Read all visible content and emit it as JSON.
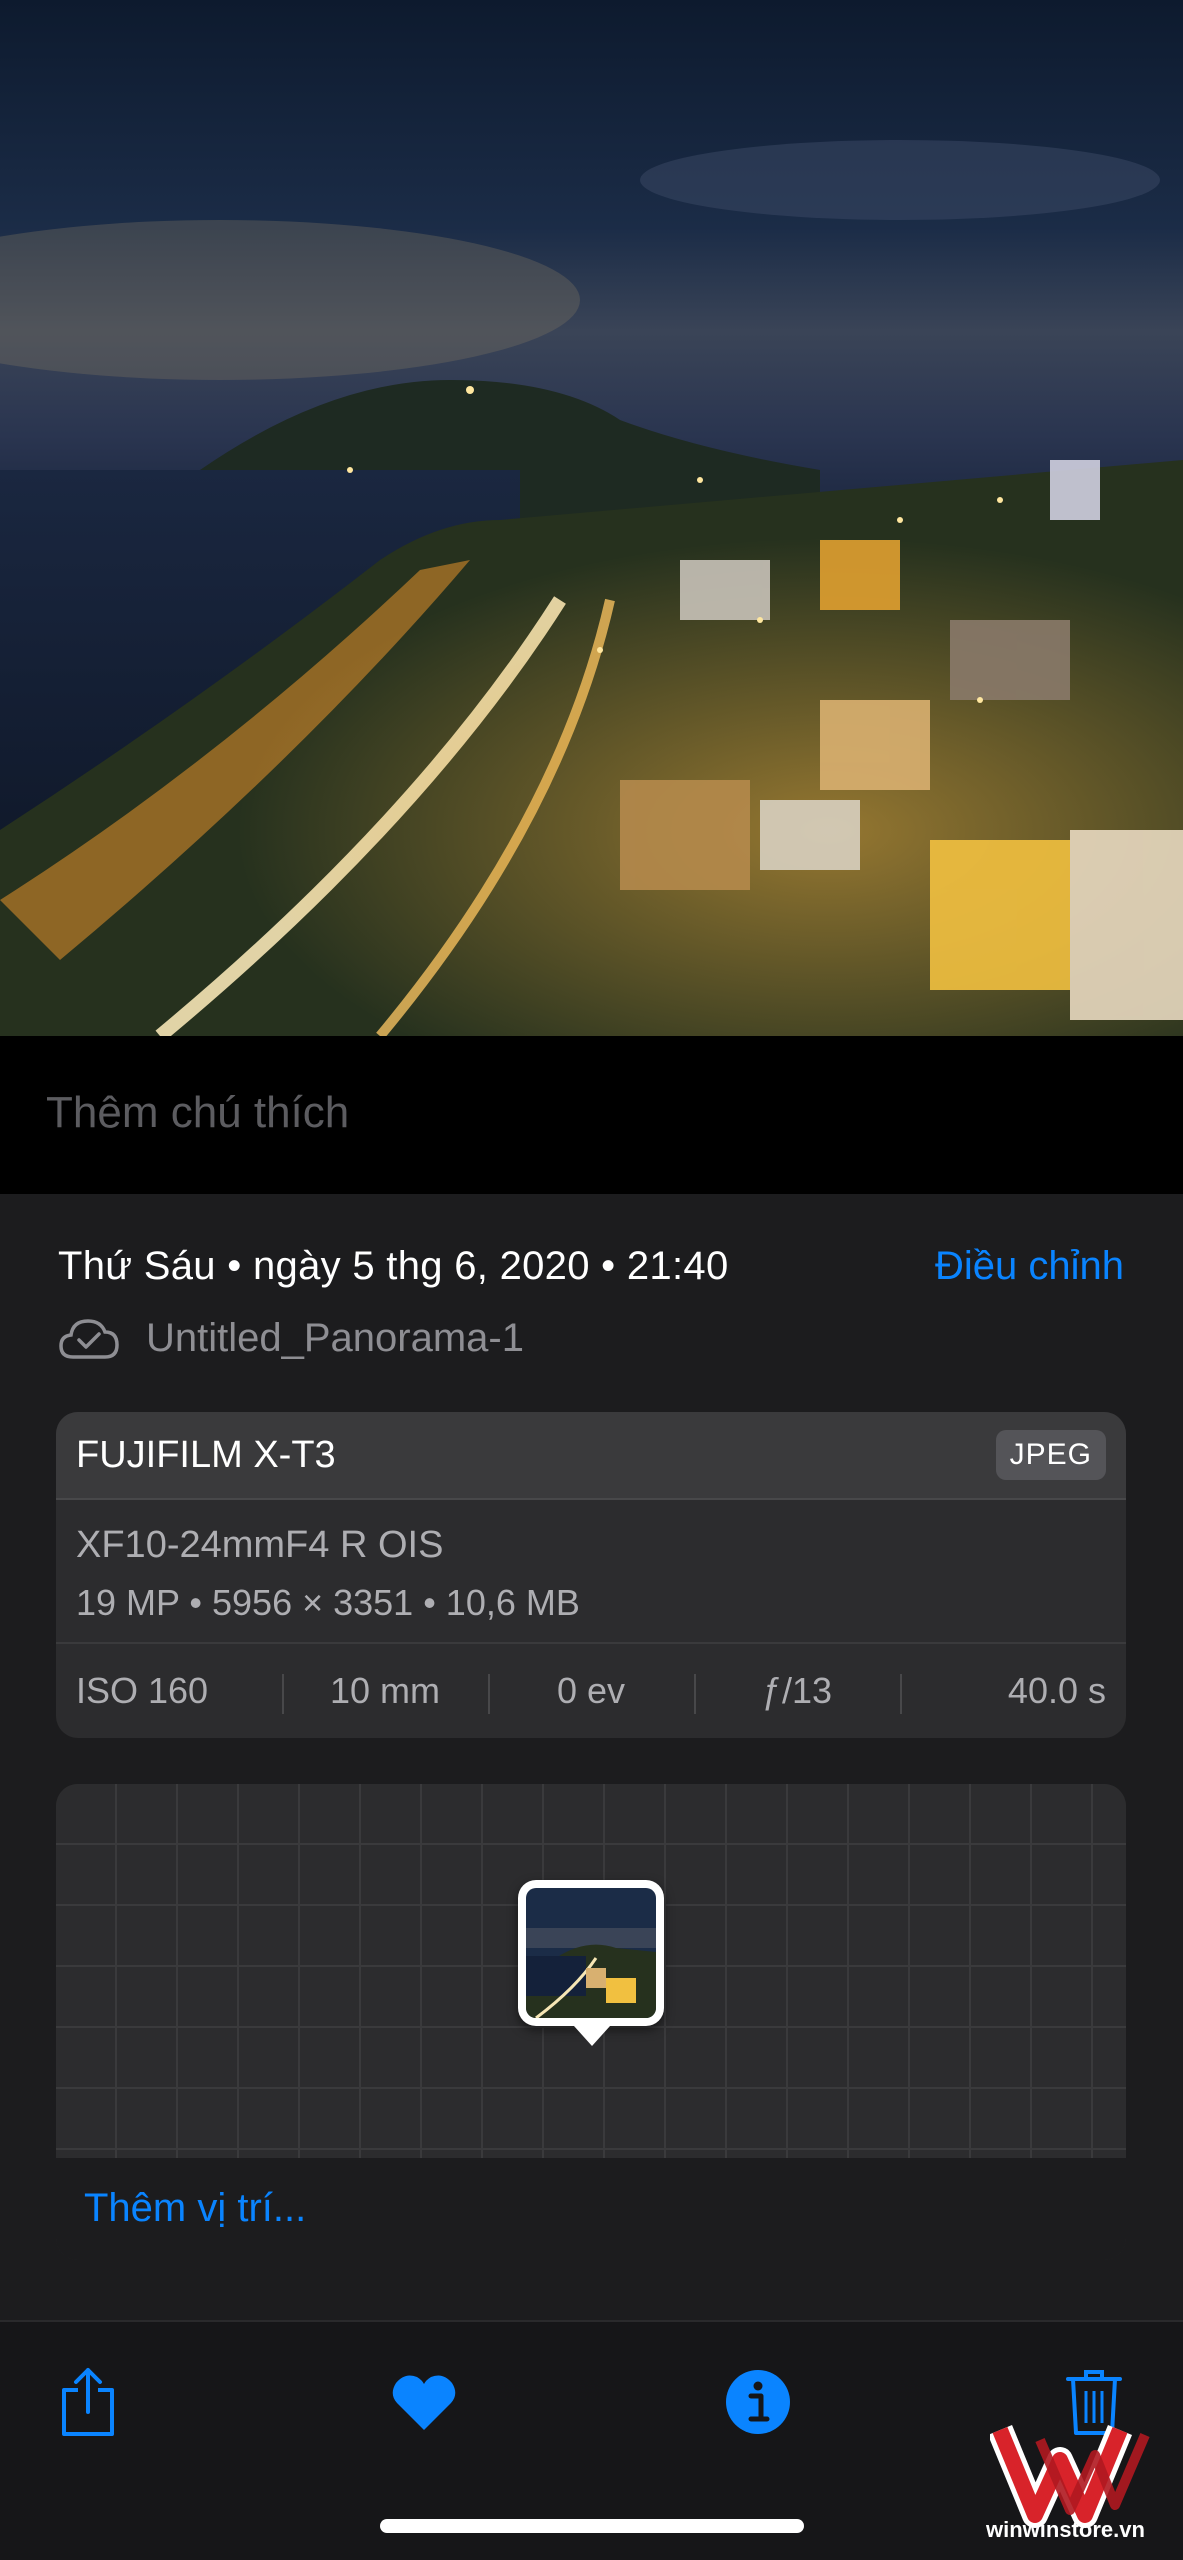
{
  "photo": {
    "description_icon": "night-city-photo"
  },
  "caption": {
    "placeholder": "Thêm chú thích"
  },
  "info": {
    "date_text": "Thứ Sáu  •  ngày 5 thg 6, 2020  •  21:40",
    "adjust_label": "Điều chỉnh",
    "file_name": "Untitled_Panorama-1"
  },
  "exif": {
    "camera": "FUJIFILM X-T3",
    "format": "JPEG",
    "lens": "XF10-24mmF4 R OIS",
    "specs": "19 MP  •  5956 × 3351  •  10,6 MB",
    "iso": "ISO 160",
    "focal": "10 mm",
    "ev": "0 ev",
    "aperture": "ƒ/13",
    "shutter": "40.0 s"
  },
  "map": {
    "add_location": "Thêm vị trí..."
  },
  "toolbar": {
    "share_icon": "share-icon",
    "favorite_icon": "heart-icon",
    "info_icon": "info-icon",
    "delete_icon": "trash-icon"
  },
  "watermark": {
    "text": "winwinstore.vn"
  },
  "colors": {
    "accent": "#0a84ff",
    "sheet_bg": "#1c1c1e",
    "card_bg": "#2c2c2e"
  }
}
